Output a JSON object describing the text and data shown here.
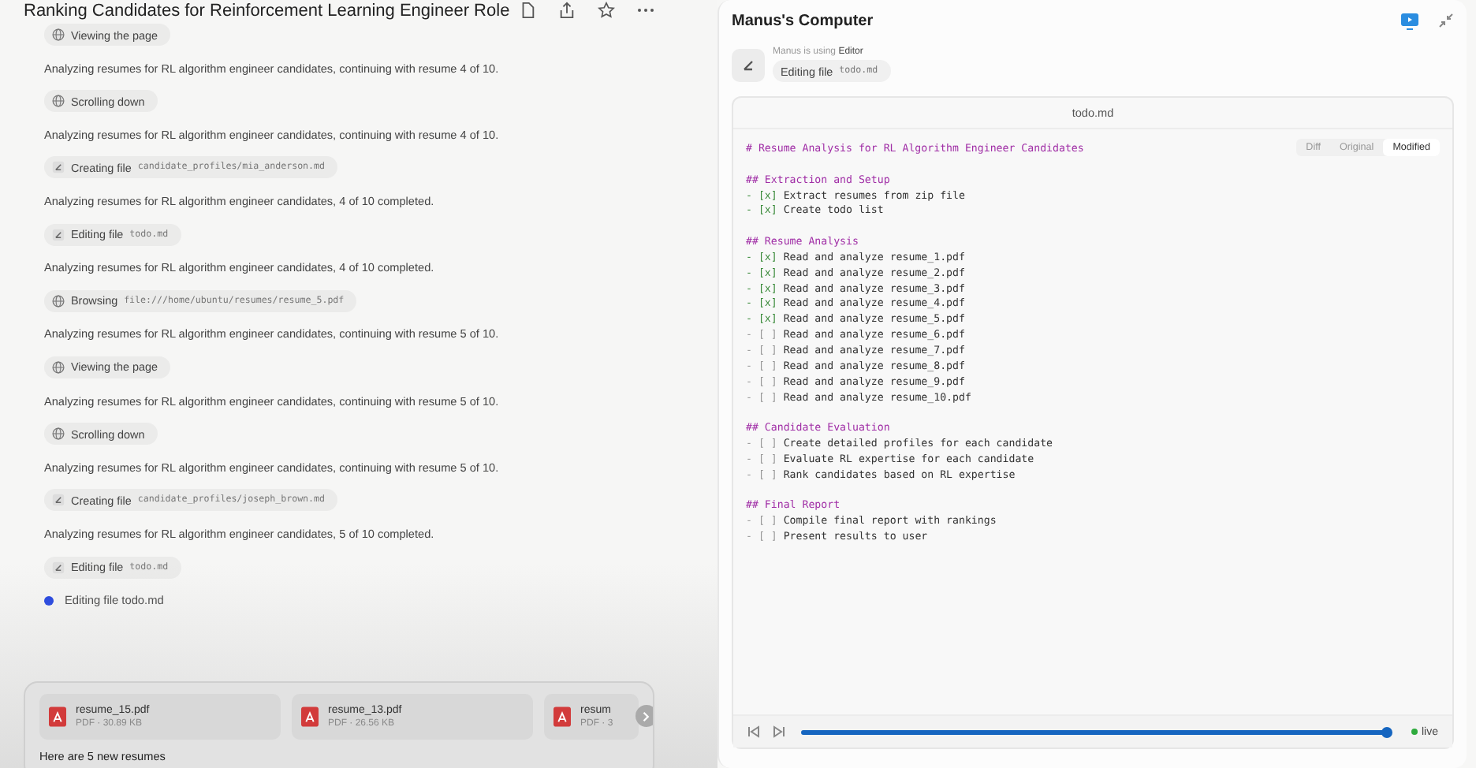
{
  "chat": {
    "title": "Ranking Candidates for Reinforcement Learning Engineer Role",
    "log": [
      {
        "kind": "browser_action",
        "label": "Viewing the page"
      },
      {
        "kind": "message",
        "text": "Analyzing resumes for RL algorithm engineer candidates, continuing with resume 4 of 10."
      },
      {
        "kind": "browser_action",
        "label": "Scrolling down"
      },
      {
        "kind": "message",
        "text": "Analyzing resumes for RL algorithm engineer candidates, continuing with resume 4 of 10."
      },
      {
        "kind": "editor_action",
        "label": "Creating file",
        "code": "candidate_profiles/mia_anderson.md"
      },
      {
        "kind": "message",
        "text": "Analyzing resumes for RL algorithm engineer candidates, 4 of 10 completed."
      },
      {
        "kind": "editor_action",
        "label": "Editing file",
        "code": "todo.md"
      },
      {
        "kind": "message",
        "text": "Analyzing resumes for RL algorithm engineer candidates, 4 of 10 completed."
      },
      {
        "kind": "browser_action",
        "label": "Browsing",
        "code": "file:///home/ubuntu/resumes/resume_5.pdf"
      },
      {
        "kind": "message",
        "text": "Analyzing resumes for RL algorithm engineer candidates, continuing with resume 5 of 10."
      },
      {
        "kind": "browser_action",
        "label": "Viewing the page"
      },
      {
        "kind": "message",
        "text": "Analyzing resumes for RL algorithm engineer candidates, continuing with resume 5 of 10."
      },
      {
        "kind": "browser_action",
        "label": "Scrolling down"
      },
      {
        "kind": "message",
        "text": "Analyzing resumes for RL algorithm engineer candidates, continuing with resume 5 of 10."
      },
      {
        "kind": "editor_action",
        "label": "Creating file",
        "code": "candidate_profiles/joseph_brown.md"
      },
      {
        "kind": "message",
        "text": "Analyzing resumes for RL algorithm engineer candidates, 5 of 10 completed."
      },
      {
        "kind": "editor_action",
        "label": "Editing file",
        "code": "todo.md"
      },
      {
        "kind": "status",
        "text": "Editing file todo.md"
      }
    ],
    "composer": {
      "attachments": [
        {
          "name": "resume_15.pdf",
          "meta": "PDF · 30.89 KB"
        },
        {
          "name": "resume_13.pdf",
          "meta": "PDF · 26.56 KB"
        },
        {
          "name": "resum",
          "meta": "PDF · 3"
        }
      ],
      "value": "Here are 5 new resumes"
    }
  },
  "computer": {
    "title": "Manus's Computer",
    "using_prefix": "Manus is using",
    "using_app": "Editor",
    "action": {
      "label": "Editing file",
      "code": "todo.md"
    },
    "editor": {
      "filename": "todo.md",
      "tabs": [
        {
          "label": "Diff",
          "selected": false
        },
        {
          "label": "Original",
          "selected": false
        },
        {
          "label": "Modified",
          "selected": true
        }
      ],
      "lines": [
        {
          "kind": "heading",
          "text": "# Resume Analysis for RL Algorithm Engineer Candidates"
        },
        {
          "kind": "blank"
        },
        {
          "kind": "heading",
          "text": "## Extraction and Setup"
        },
        {
          "kind": "task",
          "box": "- [x]",
          "checked": true,
          "text": "Extract resumes from zip file"
        },
        {
          "kind": "task",
          "box": "- [x]",
          "checked": true,
          "text": "Create todo list"
        },
        {
          "kind": "blank"
        },
        {
          "kind": "heading",
          "text": "## Resume Analysis"
        },
        {
          "kind": "task",
          "box": "- [x]",
          "checked": true,
          "text": "Read and analyze resume_1.pdf"
        },
        {
          "kind": "task",
          "box": "- [x]",
          "checked": true,
          "text": "Read and analyze resume_2.pdf"
        },
        {
          "kind": "task",
          "box": "- [x]",
          "checked": true,
          "text": "Read and analyze resume_3.pdf"
        },
        {
          "kind": "task",
          "box": "- [x]",
          "checked": true,
          "text": "Read and analyze resume_4.pdf"
        },
        {
          "kind": "task",
          "box": "- [x]",
          "checked": true,
          "text": "Read and analyze resume_5.pdf"
        },
        {
          "kind": "task",
          "box": "- [ ]",
          "checked": false,
          "text": "Read and analyze resume_6.pdf"
        },
        {
          "kind": "task",
          "box": "- [ ]",
          "checked": false,
          "text": "Read and analyze resume_7.pdf"
        },
        {
          "kind": "task",
          "box": "- [ ]",
          "checked": false,
          "text": "Read and analyze resume_8.pdf"
        },
        {
          "kind": "task",
          "box": "- [ ]",
          "checked": false,
          "text": "Read and analyze resume_9.pdf"
        },
        {
          "kind": "task",
          "box": "- [ ]",
          "checked": false,
          "text": "Read and analyze resume_10.pdf"
        },
        {
          "kind": "blank"
        },
        {
          "kind": "heading",
          "text": "## Candidate Evaluation"
        },
        {
          "kind": "task",
          "box": "- [ ]",
          "checked": false,
          "text": "Create detailed profiles for each candidate"
        },
        {
          "kind": "task",
          "box": "- [ ]",
          "checked": false,
          "text": "Evaluate RL expertise for each candidate"
        },
        {
          "kind": "task",
          "box": "- [ ]",
          "checked": false,
          "text": "Rank candidates based on RL expertise"
        },
        {
          "kind": "blank"
        },
        {
          "kind": "heading",
          "text": "## Final Report"
        },
        {
          "kind": "task",
          "box": "- [ ]",
          "checked": false,
          "text": "Compile final report with rankings"
        },
        {
          "kind": "task",
          "box": "- [ ]",
          "checked": false,
          "text": "Present results to user"
        }
      ],
      "playback": {
        "level": 0.99,
        "live": "live"
      }
    }
  }
}
